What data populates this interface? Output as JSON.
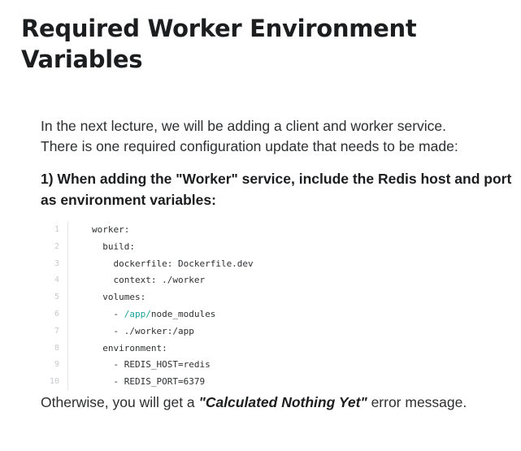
{
  "title": "Required Worker Environment Variables",
  "intro": {
    "line1": "In the next lecture, we will be adding a client and worker service.",
    "line2": "There is one required configuration update that needs to be made:"
  },
  "step": "1) When adding the \"Worker\" service, include the Redis host and port as environment variables:",
  "code": {
    "lines": [
      {
        "num": "1",
        "text": "worker:"
      },
      {
        "num": "2",
        "text": "  build:"
      },
      {
        "num": "3",
        "text": "    dockerfile: Dockerfile.dev"
      },
      {
        "num": "4",
        "text": "    context: ./worker"
      },
      {
        "num": "5",
        "text": "  volumes:"
      },
      {
        "num": "6",
        "prefix": "    - ",
        "highlight": "/app/",
        "suffix": "node_modules"
      },
      {
        "num": "7",
        "text": "    - ./worker:/app"
      },
      {
        "num": "8",
        "text": "  environment:"
      },
      {
        "num": "9",
        "text": "    - REDIS_HOST=redis"
      },
      {
        "num": "10",
        "text": "    - REDIS_PORT=6379"
      }
    ],
    "highlight_color": "#1aa396"
  },
  "outro": {
    "before": "Otherwise, you will get a ",
    "emphasis": "\"Calculated Nothing Yet\"",
    "after": " error message."
  }
}
